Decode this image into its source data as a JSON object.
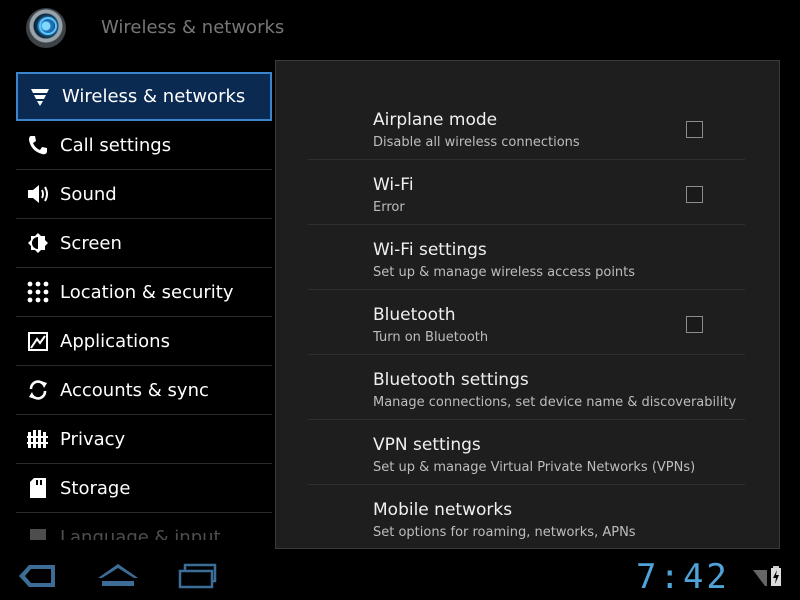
{
  "action_bar": {
    "app_icon": "settings-app-icon",
    "title": "Wireless & networks"
  },
  "left_list": {
    "items": [
      {
        "label": "Wireless & networks",
        "icon": "wifi-icon",
        "selected": true
      },
      {
        "label": "Call settings",
        "icon": "phone-icon"
      },
      {
        "label": "Sound",
        "icon": "speaker-icon"
      },
      {
        "label": "Screen",
        "icon": "brightness-icon"
      },
      {
        "label": "Location & security",
        "icon": "location-grid-icon"
      },
      {
        "label": "Applications",
        "icon": "applications-icon"
      },
      {
        "label": "Accounts & sync",
        "icon": "sync-icon"
      },
      {
        "label": "Privacy",
        "icon": "privacy-icon"
      },
      {
        "label": "Storage",
        "icon": "sd-card-icon"
      },
      {
        "label": "Language & input",
        "icon": "language-icon"
      }
    ]
  },
  "preferences": [
    {
      "title": "Airplane mode",
      "summary": "Disable all wireless connections",
      "checkbox": true,
      "checked": false
    },
    {
      "title": "Wi-Fi",
      "summary": "Error",
      "checkbox": true,
      "checked": false
    },
    {
      "title": "Wi-Fi settings",
      "summary": "Set up & manage wireless access points",
      "checkbox": false
    },
    {
      "title": "Bluetooth",
      "summary": "Turn on Bluetooth",
      "checkbox": true,
      "checked": false
    },
    {
      "title": "Bluetooth settings",
      "summary": "Manage connections, set device name & discoverability",
      "checkbox": false
    },
    {
      "title": "VPN settings",
      "summary": "Set up & manage Virtual Private Networks (VPNs)",
      "checkbox": false
    },
    {
      "title": "Mobile networks",
      "summary": "Set options for roaming, networks, APNs",
      "checkbox": false
    }
  ],
  "system_bar": {
    "back_icon": "back-icon",
    "home_icon": "home-icon",
    "recents_icon": "recent-apps-icon",
    "clock": "7:42",
    "signal_icon": "signal-icon",
    "battery_icon": "battery-charging-icon"
  },
  "colors": {
    "accent": "#3c84cb",
    "selected_bg": "#0b2a52",
    "clock": "#4fa3d8"
  }
}
